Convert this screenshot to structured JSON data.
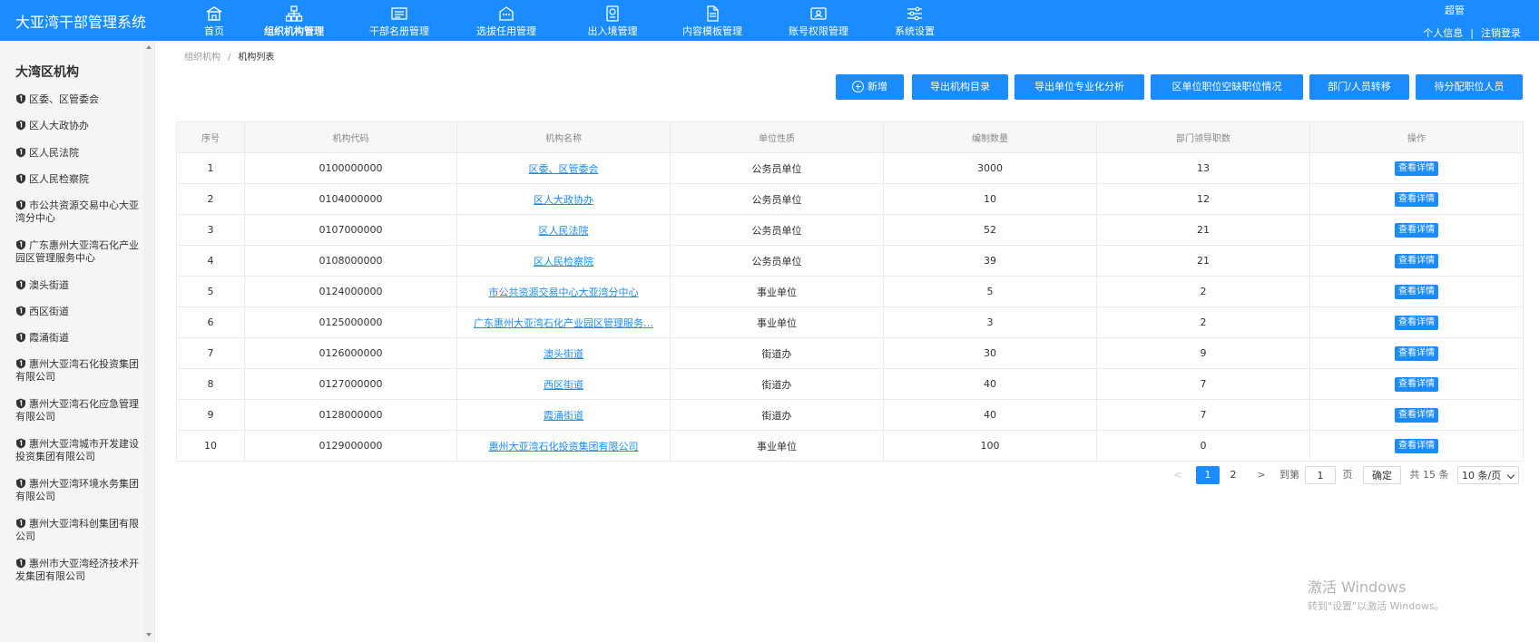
{
  "app": {
    "title": "大亚湾干部管理系统"
  },
  "nav": [
    {
      "label": "首页",
      "icon": "home-icon"
    },
    {
      "label": "组织机构管理",
      "icon": "org-chart-icon"
    },
    {
      "label": "干部名册管理",
      "icon": "roster-icon"
    },
    {
      "label": "选拔任用管理",
      "icon": "appointment-icon"
    },
    {
      "label": "出入境管理",
      "icon": "passport-icon"
    },
    {
      "label": "内容模板管理",
      "icon": "document-icon"
    },
    {
      "label": "账号权限管理",
      "icon": "id-card-icon"
    },
    {
      "label": "系统设置",
      "icon": "settings-sliders-icon"
    }
  ],
  "nav_active_index": 1,
  "user": {
    "name": "超管",
    "profile_link": "个人信息",
    "separator": "|",
    "logout_link": "注销登录"
  },
  "sidebar": {
    "title": "大湾区机构",
    "items": [
      {
        "label": "区委、区管委会"
      },
      {
        "label": "区人大政协办"
      },
      {
        "label": "区人民法院"
      },
      {
        "label": "区人民检察院"
      },
      {
        "label": "市公共资源交易中心大亚湾分中心"
      },
      {
        "label": "广东惠州大亚湾石化产业园区管理服务中心"
      },
      {
        "label": "澳头街道"
      },
      {
        "label": "西区街道"
      },
      {
        "label": "霞涌街道"
      },
      {
        "label": "惠州大亚湾石化投资集团有限公司"
      },
      {
        "label": "惠州大亚湾石化应急管理有限公司"
      },
      {
        "label": "惠州大亚湾城市开发建设投资集团有限公司"
      },
      {
        "label": "惠州大亚湾环境水务集团有限公司"
      },
      {
        "label": "惠州大亚湾科创集团有限公司"
      },
      {
        "label": "惠州市大亚湾经济技术开发集团有限公司"
      }
    ]
  },
  "breadcrumb": {
    "parent": "组织机构",
    "separator": "/",
    "current": "机构列表"
  },
  "toolbar": {
    "add": "新增",
    "export_catalog": "导出机构目录",
    "export_analysis": "导出单位专业化分析",
    "vacancy": "区单位职位空缺职位情况",
    "transfer": "部门/人员转移",
    "pending": "待分配职位人员"
  },
  "table": {
    "headers": [
      "序号",
      "机构代码",
      "机构名称",
      "单位性质",
      "编制数量",
      "部门领导职数",
      "操作"
    ],
    "action_label": "查看详情",
    "rows": [
      [
        "1",
        "0100000000",
        "区委、区管委会",
        "公务员单位",
        "3000",
        "13"
      ],
      [
        "2",
        "0104000000",
        "区人大政协办",
        "公务员单位",
        "10",
        "12"
      ],
      [
        "3",
        "0107000000",
        "区人民法院",
        "公务员单位",
        "52",
        "21"
      ],
      [
        "4",
        "0108000000",
        "区人民检察院",
        "公务员单位",
        "39",
        "21"
      ],
      [
        "5",
        "0124000000",
        "市公共资源交易中心大亚湾分中心",
        "事业单位",
        "5",
        "2"
      ],
      [
        "6",
        "0125000000",
        "广东惠州大亚湾石化产业园区管理服务…",
        "事业单位",
        "3",
        "2"
      ],
      [
        "7",
        "0126000000",
        "澳头街道",
        "街道办",
        "30",
        "9"
      ],
      [
        "8",
        "0127000000",
        "西区街道",
        "街道办",
        "40",
        "7"
      ],
      [
        "9",
        "0128000000",
        "霞涌街道",
        "街道办",
        "40",
        "7"
      ],
      [
        "10",
        "0129000000",
        "惠州大亚湾石化投资集团有限公司",
        "事业单位",
        "100",
        "0"
      ]
    ]
  },
  "pagination": {
    "prev": "<",
    "pages": [
      "1",
      "2"
    ],
    "current_page": 1,
    "next": ">",
    "goto_prefix": "到第",
    "goto_value": "1",
    "goto_suffix": "页",
    "confirm": "确定",
    "total": "共 15 条",
    "page_size": "10 条/页"
  },
  "watermark": {
    "line1": "激活 Windows",
    "line2": "转到\"设置\"以激活 Windows。"
  },
  "colors": {
    "primary": "#1a8cff",
    "sidebar_bg": "#f5f5f5",
    "header_bg": "#f7f7f7"
  }
}
